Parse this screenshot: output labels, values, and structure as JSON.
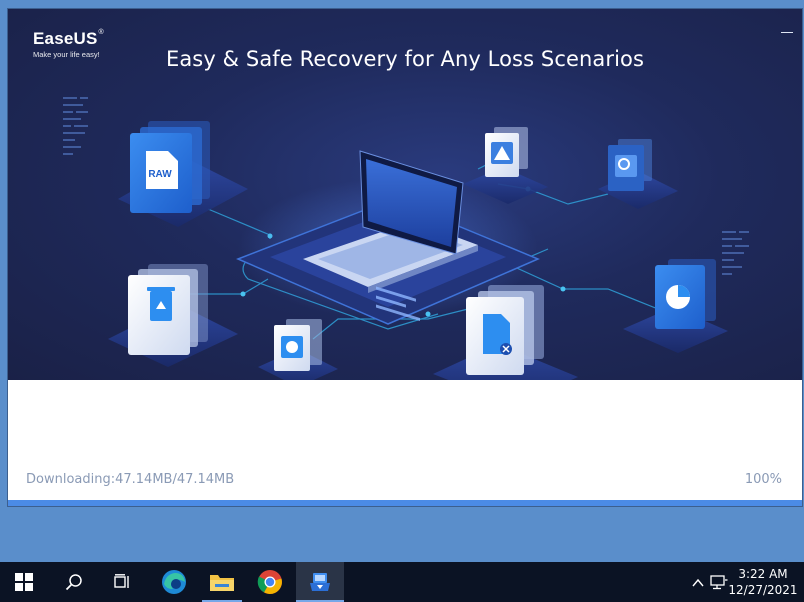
{
  "installer": {
    "logo": {
      "brand": "EaseUS",
      "mark": "®",
      "tagline": "Make your life easy!"
    },
    "headline": "Easy & Safe Recovery for Any Loss Scenarios",
    "progress": {
      "status_text": "Downloading:47.14MB/47.14MB",
      "percent_text": "100%",
      "fraction": 1.0
    },
    "file_cards": [
      {
        "name": "raw-file-card",
        "label": "RAW"
      }
    ],
    "colors": {
      "hero_bg": "#1f2a5c",
      "accent": "#4b8be6",
      "progress_text": "#8a9ab5"
    }
  },
  "taskbar": {
    "items": [
      {
        "name": "start-button",
        "icon": "windows-logo-icon"
      },
      {
        "name": "search-button",
        "icon": "search-icon"
      },
      {
        "name": "task-view-button",
        "icon": "task-view-icon"
      },
      {
        "name": "edge-button",
        "icon": "edge-icon"
      },
      {
        "name": "file-explorer-button",
        "icon": "folder-icon"
      },
      {
        "name": "chrome-button",
        "icon": "chrome-icon"
      },
      {
        "name": "easeus-installer-button",
        "icon": "easeus-installer-icon"
      }
    ],
    "tray": {
      "time": "3:22 AM",
      "date": "12/27/2021"
    }
  }
}
